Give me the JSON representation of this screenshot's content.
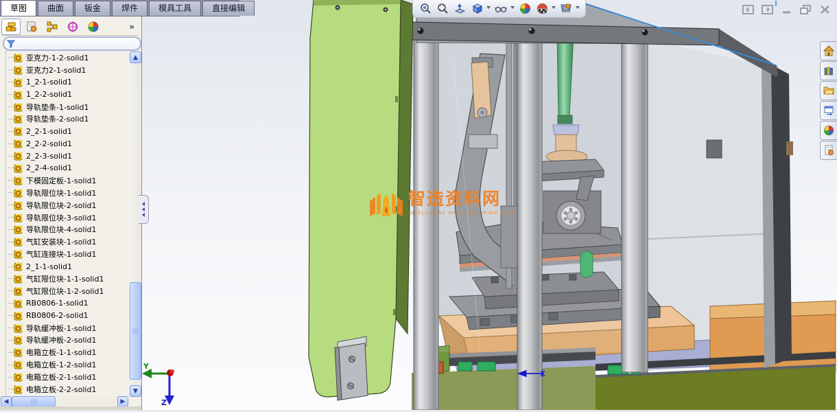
{
  "command_tabs": [
    {
      "label": "草图",
      "active": true
    },
    {
      "label": "曲面"
    },
    {
      "label": "钣金"
    },
    {
      "label": "焊件"
    },
    {
      "label": "模具工具"
    },
    {
      "label": "直接编辑"
    }
  ],
  "feature_panel": {
    "tabs": [
      "features-tab",
      "property-manager-tab",
      "configuration-manager-tab",
      "dimxpert-tab",
      "display-manager-tab"
    ],
    "overflow_label": "»",
    "filter_placeholder": "",
    "items": [
      "亚克力-1-2-solid1",
      "亚克力2-1-solid1",
      "1_2-1-solid1",
      "1_2-2-solid1",
      "导轨垫条-1-solid1",
      "导轨垫条-2-solid1",
      "2_2-1-solid1",
      "2_2-2-solid1",
      "2_2-3-solid1",
      "2_2-4-solid1",
      "下模固定板-1-solid1",
      "导轨限位块-1-solid1",
      "导轨限位块-2-solid1",
      "导轨限位块-3-solid1",
      "导轨限位块-4-solid1",
      "气缸安装块-1-solid1",
      "气缸连接块-1-solid1",
      "2_1-1-solid1",
      "气缸限位块-1-1-solid1",
      "气缸限位块-1-2-solid1",
      "RB0806-1-solid1",
      "RB0806-2-solid1",
      "导轨缓冲板-1-solid1",
      "导轨缓冲板-2-solid1",
      "电箱立板-1-1-solid1",
      "电箱立板-1-2-solid1",
      "电箱立板-2-1-solid1",
      "电箱立板-2-2-solid1"
    ]
  },
  "view_toolbar_icons": [
    "zoom-fit-icon",
    "zoom-area-icon",
    "section-view-icon",
    "view-orientation-icon",
    "display-style-icon",
    "hide-show-items-icon",
    "edit-appearance-icon",
    "apply-scene-icon"
  ],
  "window_controls": [
    "dock-left-button",
    "dock-right-button",
    "minimize-button",
    "restore-button",
    "close-button"
  ],
  "task_pane_tabs": [
    "resources-tab",
    "design-library-tab",
    "file-explorer-tab",
    "view-palette-tab",
    "appearances-scenes-tab",
    "custom-properties-tab"
  ],
  "watermark": {
    "title": "智造资料网",
    "subtitle": "INTELLIGENT MANUFACTURING DATA"
  },
  "triad": {
    "y_label": "Y",
    "z_label": "Z"
  },
  "colors": {
    "green_panel": "#b7dc80",
    "orange_base": "#e09a52",
    "lavender_layer": "#a9aed2",
    "olive_floor": "#8b9a56",
    "green_rod": "#3cae62",
    "watermark_orange": "#f08020",
    "selection_blue": "#2f8fe8"
  }
}
